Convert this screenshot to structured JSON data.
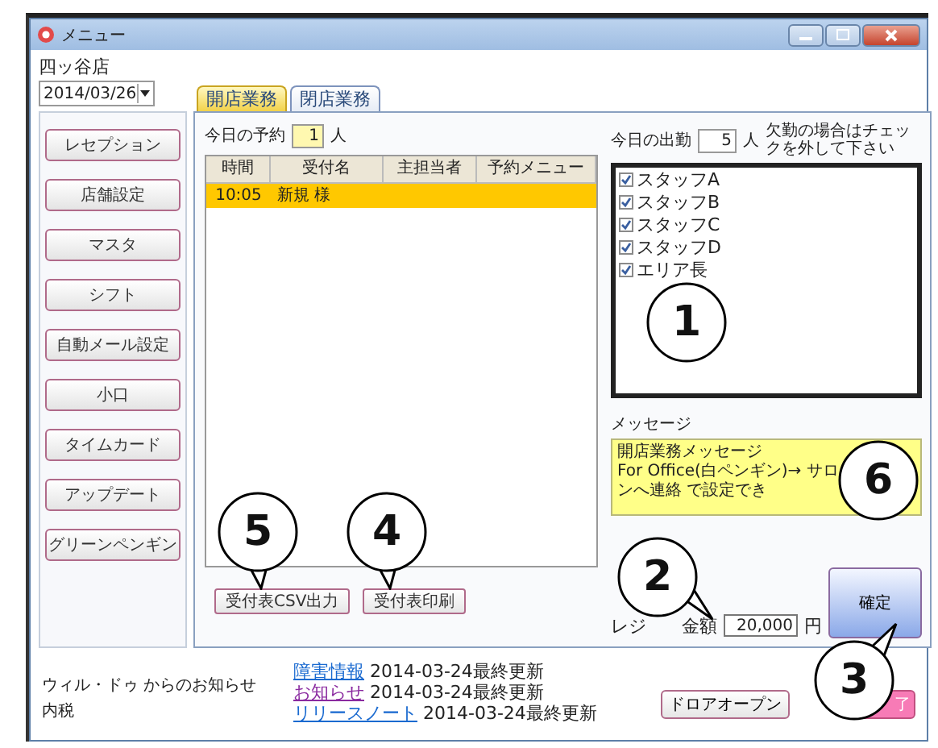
{
  "window": {
    "title": "メニュー"
  },
  "store": "四ッ谷店",
  "date_field": {
    "value": "2014/03/26"
  },
  "tabs": [
    {
      "label": "開店業務",
      "selected": true
    },
    {
      "label": "閉店業務",
      "selected": false
    }
  ],
  "sidebar": {
    "items": [
      "レセプション",
      "店舗設定",
      "マスタ",
      "シフト",
      "自動メール設定",
      "小口",
      "タイムカード",
      "アップデート",
      "グリーンペンギン"
    ]
  },
  "reservations": {
    "label": "今日の予約",
    "count": "1",
    "unit": "人",
    "columns": [
      "時間",
      "受付名",
      "主担当者",
      "予約メニュー"
    ],
    "rows": [
      {
        "time": "10:05",
        "name": "新規 様",
        "selected": true
      }
    ]
  },
  "table_buttons": [
    "受付表CSV出力",
    "受付表印刷"
  ],
  "attendance": {
    "label": "今日の出勤",
    "count": "5",
    "unit": "人",
    "hint": "欠勤の場合はチェックを外して下さい",
    "staff": [
      {
        "name": "スタッフA",
        "checked": true
      },
      {
        "name": "スタッフB",
        "checked": true
      },
      {
        "name": "スタッフC",
        "checked": true
      },
      {
        "name": "スタッフD",
        "checked": true
      },
      {
        "name": "エリア長",
        "checked": true
      }
    ]
  },
  "message": {
    "label": "メッセージ",
    "lines": [
      "開店業務メッセージ",
      "For Office(白ペンギン)→ サロンへ連絡 で設定でき"
    ]
  },
  "register": {
    "label_parts": [
      "レジ",
      "金額"
    ],
    "amount": "20,000",
    "unit": "円"
  },
  "confirm_button": "確定",
  "notices": {
    "source": "ウィル・ドゥ からのお知らせ",
    "tax": "内税",
    "links": [
      {
        "link": "障害情報",
        "text": "2014-03-24最終更新",
        "visited": false
      },
      {
        "link": "お知らせ",
        "text": "2014-03-24最終更新",
        "visited": true
      },
      {
        "link": "リリースノート",
        "text": "2014-03-24最終更新",
        "visited": false
      }
    ]
  },
  "drawer_button": "ドロアオープン",
  "end_button": "了",
  "callouts": [
    {
      "number": "1",
      "kind": "round"
    },
    {
      "number": "6",
      "kind": "round"
    },
    {
      "number": "5",
      "kind": "down"
    },
    {
      "number": "4",
      "kind": "down"
    },
    {
      "number": "2",
      "kind": "downright"
    },
    {
      "number": "3",
      "kind": "upright"
    }
  ]
}
